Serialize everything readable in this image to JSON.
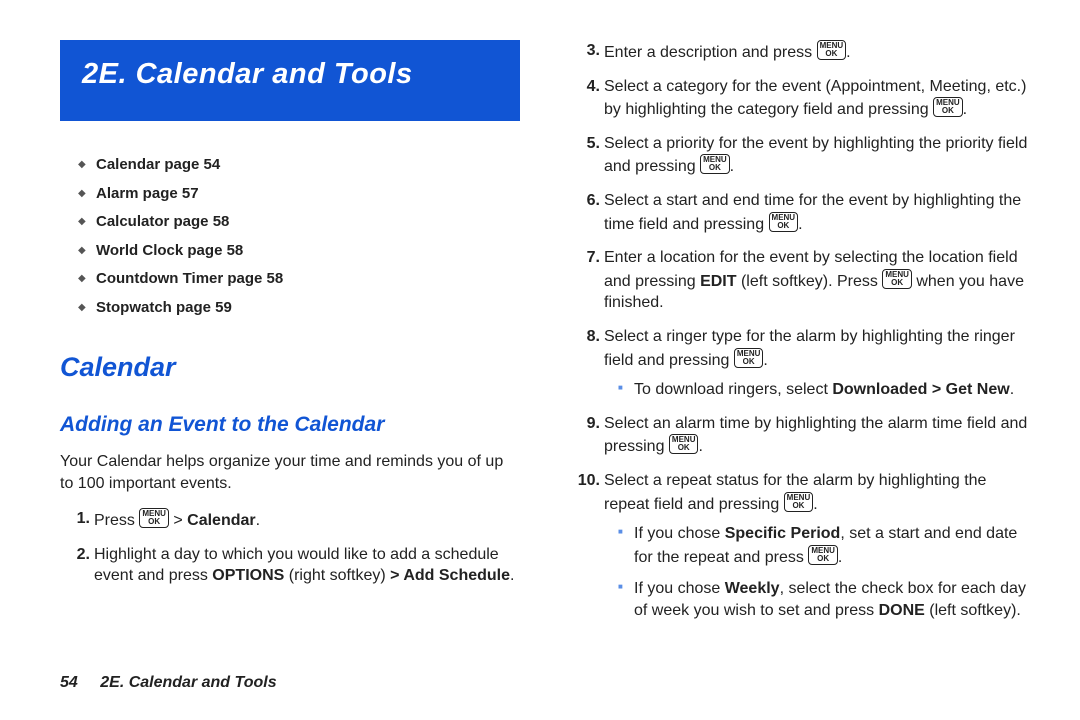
{
  "banner": {
    "title": "2E. Calendar and Tools"
  },
  "toc": {
    "items": [
      {
        "label": "Calendar page 54"
      },
      {
        "label": "Alarm page 57"
      },
      {
        "label": "Calculator page 58"
      },
      {
        "label": "World Clock page 58"
      },
      {
        "label": "Countdown Timer page 58"
      },
      {
        "label": "Stopwatch page 59"
      }
    ]
  },
  "heading1": "Calendar",
  "heading2": "Adding an Event to the Calendar",
  "intro": "Your Calendar helps organize your time and reminds you of up to 100 important events.",
  "key_label_top": "MENU",
  "key_label_bottom": "OK",
  "left_steps": {
    "s1_num": "1.",
    "s1_a": "Press ",
    "s1_b": " > ",
    "s1_calendar": "Calendar",
    "s1_c": ".",
    "s2_num": "2.",
    "s2_a": "Highlight a day to which you would like to add a schedule event and press ",
    "s2_options": "OPTIONS",
    "s2_b": " (right softkey) ",
    "s2_c": "> ",
    "s2_add": "Add Schedule",
    "s2_d": "."
  },
  "right_steps": {
    "s3_num": "3.",
    "s3_a": "Enter a description and press ",
    "s3_b": ".",
    "s4_num": "4.",
    "s4_a": "Select a category for the event (Appointment, Meeting, etc.) by highlighting the category field and pressing ",
    "s4_b": ".",
    "s5_num": "5.",
    "s5_a": "Select a priority for the event by highlighting the priority field and pressing ",
    "s5_b": ".",
    "s6_num": "6.",
    "s6_a": "Select a start and end time for the event by highlighting the time field and pressing ",
    "s6_b": ".",
    "s7_num": "7.",
    "s7_a": "Enter a location for the event by selecting the location field and pressing ",
    "s7_edit": "EDIT",
    "s7_b": " (left softkey). Press ",
    "s7_c": " when you have finished.",
    "s8_num": "8.",
    "s8_a": "Select a ringer type for the alarm by highlighting the ringer field and pressing ",
    "s8_b": ".",
    "s8_sub_a": "To download ringers, select ",
    "s8_sub_b": "Downloaded > Get New",
    "s8_sub_c": ".",
    "s9_num": "9.",
    "s9_a": "Select an alarm time by highlighting the alarm time field and pressing ",
    "s9_b": ".",
    "s10_num": "10.",
    "s10_a": "Select a repeat status for the alarm by highlighting the repeat field and pressing ",
    "s10_b": ".",
    "s10_sub1_a": "If you chose ",
    "s10_sub1_b": "Specific Period",
    "s10_sub1_c": ", set a start and end date for the repeat and press ",
    "s10_sub1_d": ".",
    "s10_sub2_a": "If you chose ",
    "s10_sub2_b": "Weekly",
    "s10_sub2_c": ", select the check box for each day of week you wish to set and press ",
    "s10_sub2_d": "DONE",
    "s10_sub2_e": " (left softkey)."
  },
  "footer": {
    "page_number": "54",
    "section_title": "2E. Calendar and Tools"
  }
}
